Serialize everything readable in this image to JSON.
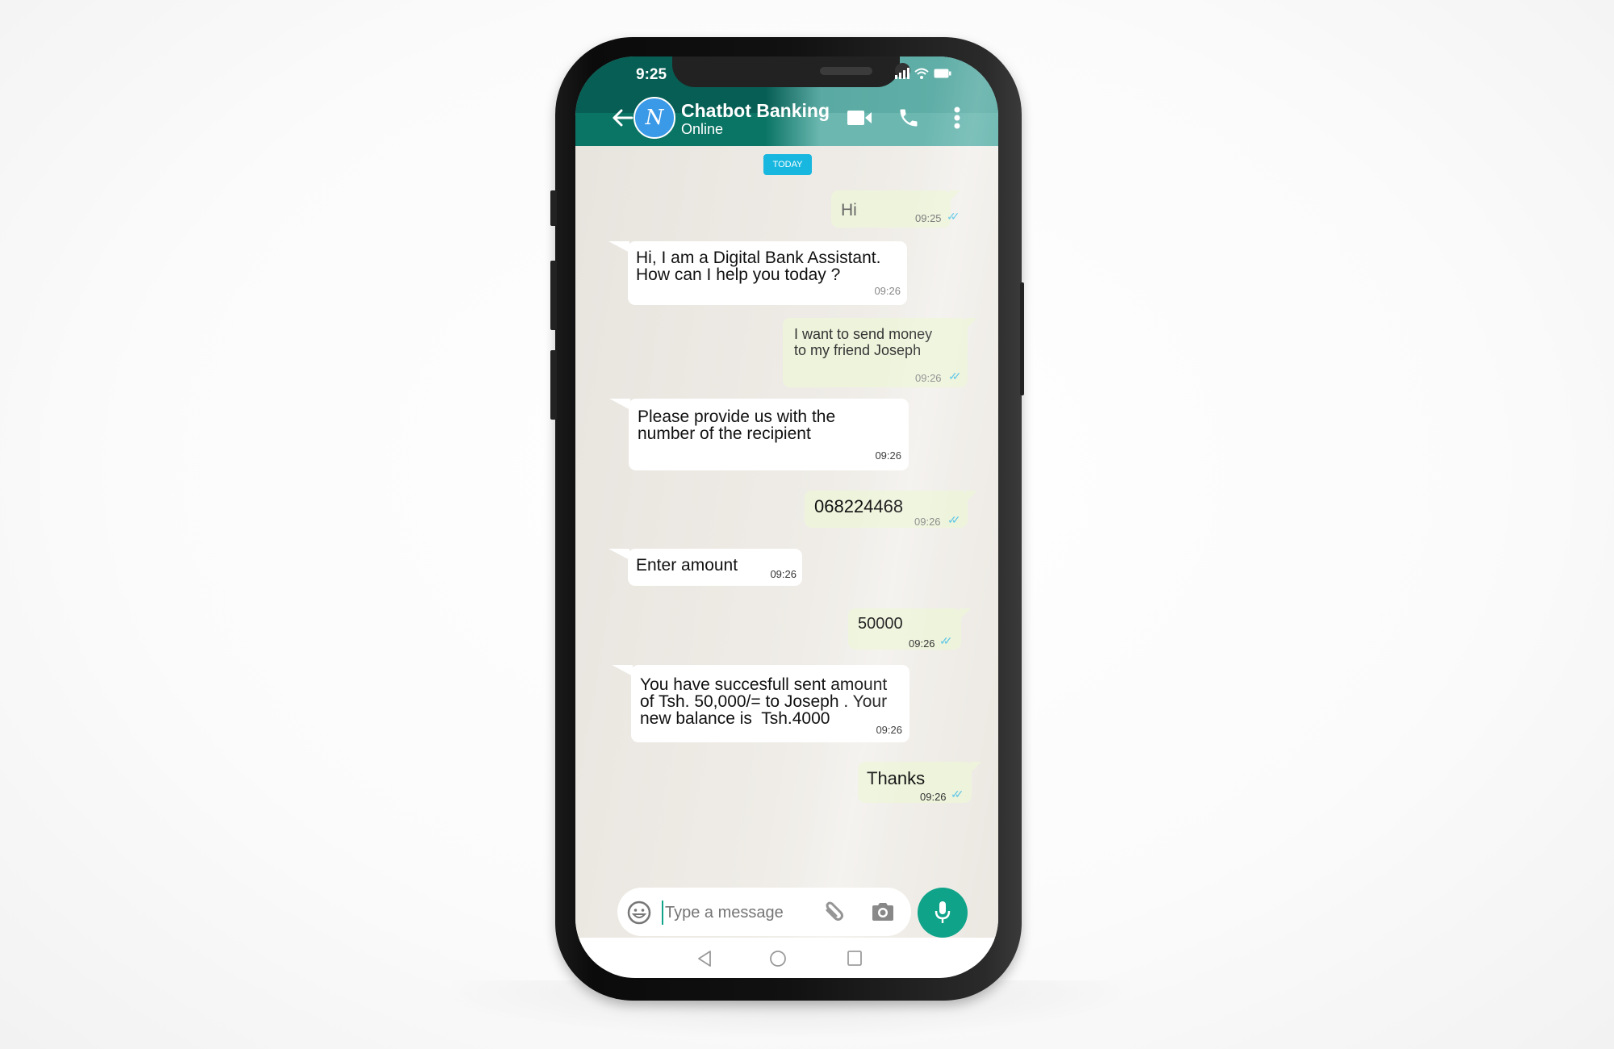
{
  "status_bar": {
    "time": "9:25"
  },
  "header": {
    "avatar_letter": "N",
    "title": "Chatbot Banking",
    "subtitle": "Online",
    "icons": [
      "back-arrow-icon",
      "video-call-icon",
      "phone-call-icon",
      "more-vert-icon"
    ]
  },
  "chat": {
    "date_badge": "TODAY",
    "messages": [
      {
        "direction": "outgoing",
        "text": "Hi",
        "time": "09:25",
        "status": "read"
      },
      {
        "direction": "incoming",
        "text": "Hi, I am a Digital Bank Assistant.\nHow can I help you today ?",
        "time": "09:26"
      },
      {
        "direction": "outgoing",
        "text": "I want to send money\nto my friend Joseph",
        "time": "09:26",
        "status": "read"
      },
      {
        "direction": "incoming",
        "text": "Please provide us with the\nnumber of the recipient",
        "time": "09:26"
      },
      {
        "direction": "outgoing",
        "text": "068224468",
        "time": "09:26",
        "status": "read"
      },
      {
        "direction": "incoming",
        "text": "Enter amount",
        "time": "09:26"
      },
      {
        "direction": "outgoing",
        "text": "50000",
        "time": "09:26",
        "status": "read"
      },
      {
        "direction": "incoming",
        "text": "You have succesfull sent amount\nof Tsh. 50,000/= to Joseph . Your\nnew balance is  Tsh.4000",
        "time": "09:26"
      },
      {
        "direction": "outgoing",
        "text": "Thanks",
        "time": "09:26",
        "status": "read"
      }
    ]
  },
  "composer": {
    "placeholder": "Type a message",
    "value": ""
  },
  "colors": {
    "header": "#075e54",
    "accent_mic": "#0fa38a",
    "date_badge": "#17b7e0",
    "avatar": "#3a9ae8",
    "outgoing_bubble": "#eef4dc",
    "incoming_bubble": "#ffffff",
    "read_tick": "#5cc5e6"
  }
}
